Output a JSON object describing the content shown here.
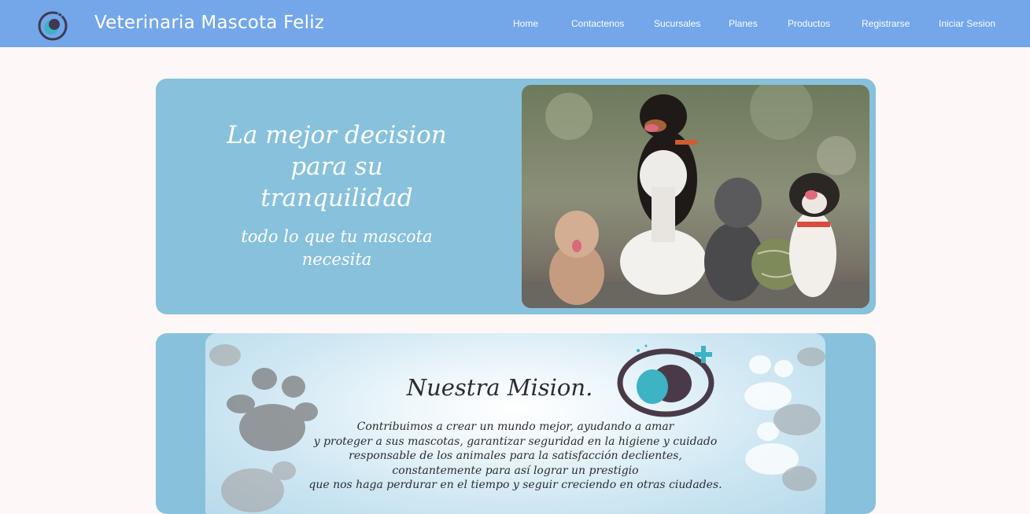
{
  "header": {
    "brand": "Veterinaria Mascota Feliz",
    "logo_icon": "pet-clinic-logo-icon",
    "nav": [
      {
        "label": "Home"
      },
      {
        "label": "Contactenos"
      },
      {
        "label": "Sucursales"
      },
      {
        "label": "Planes"
      },
      {
        "label": "Productos"
      },
      {
        "label": "Registrarse"
      },
      {
        "label": "Iniciar Sesion"
      }
    ]
  },
  "hero": {
    "title_lines": [
      "La mejor decision",
      "para su",
      "tranquilidad"
    ],
    "subtitle_lines": [
      "todo lo que tu mascota",
      "necesita"
    ],
    "photo": "dogs-group-photo"
  },
  "mission": {
    "title": "Nuestra Mision.",
    "logo_icon": "pet-clinic-logo-icon",
    "body_lines": [
      "Contribuimos a crear un mundo mejor, ayudando a amar",
      "y proteger a sus mascotas, garantizar seguridad en la higiene y cuidado",
      "responsable de los animales para la satisfacción declientes,",
      "constantemente para así lograr un prestigio",
      "que nos haga perdurar en el tiempo y seguir creciendo en otras ciudades."
    ]
  },
  "colors": {
    "navbar": "#74a6ea",
    "panel": "#88c1db",
    "page": "#fdf8f7",
    "accent": "#3db3c4",
    "logo_dark": "#4a3a48"
  }
}
